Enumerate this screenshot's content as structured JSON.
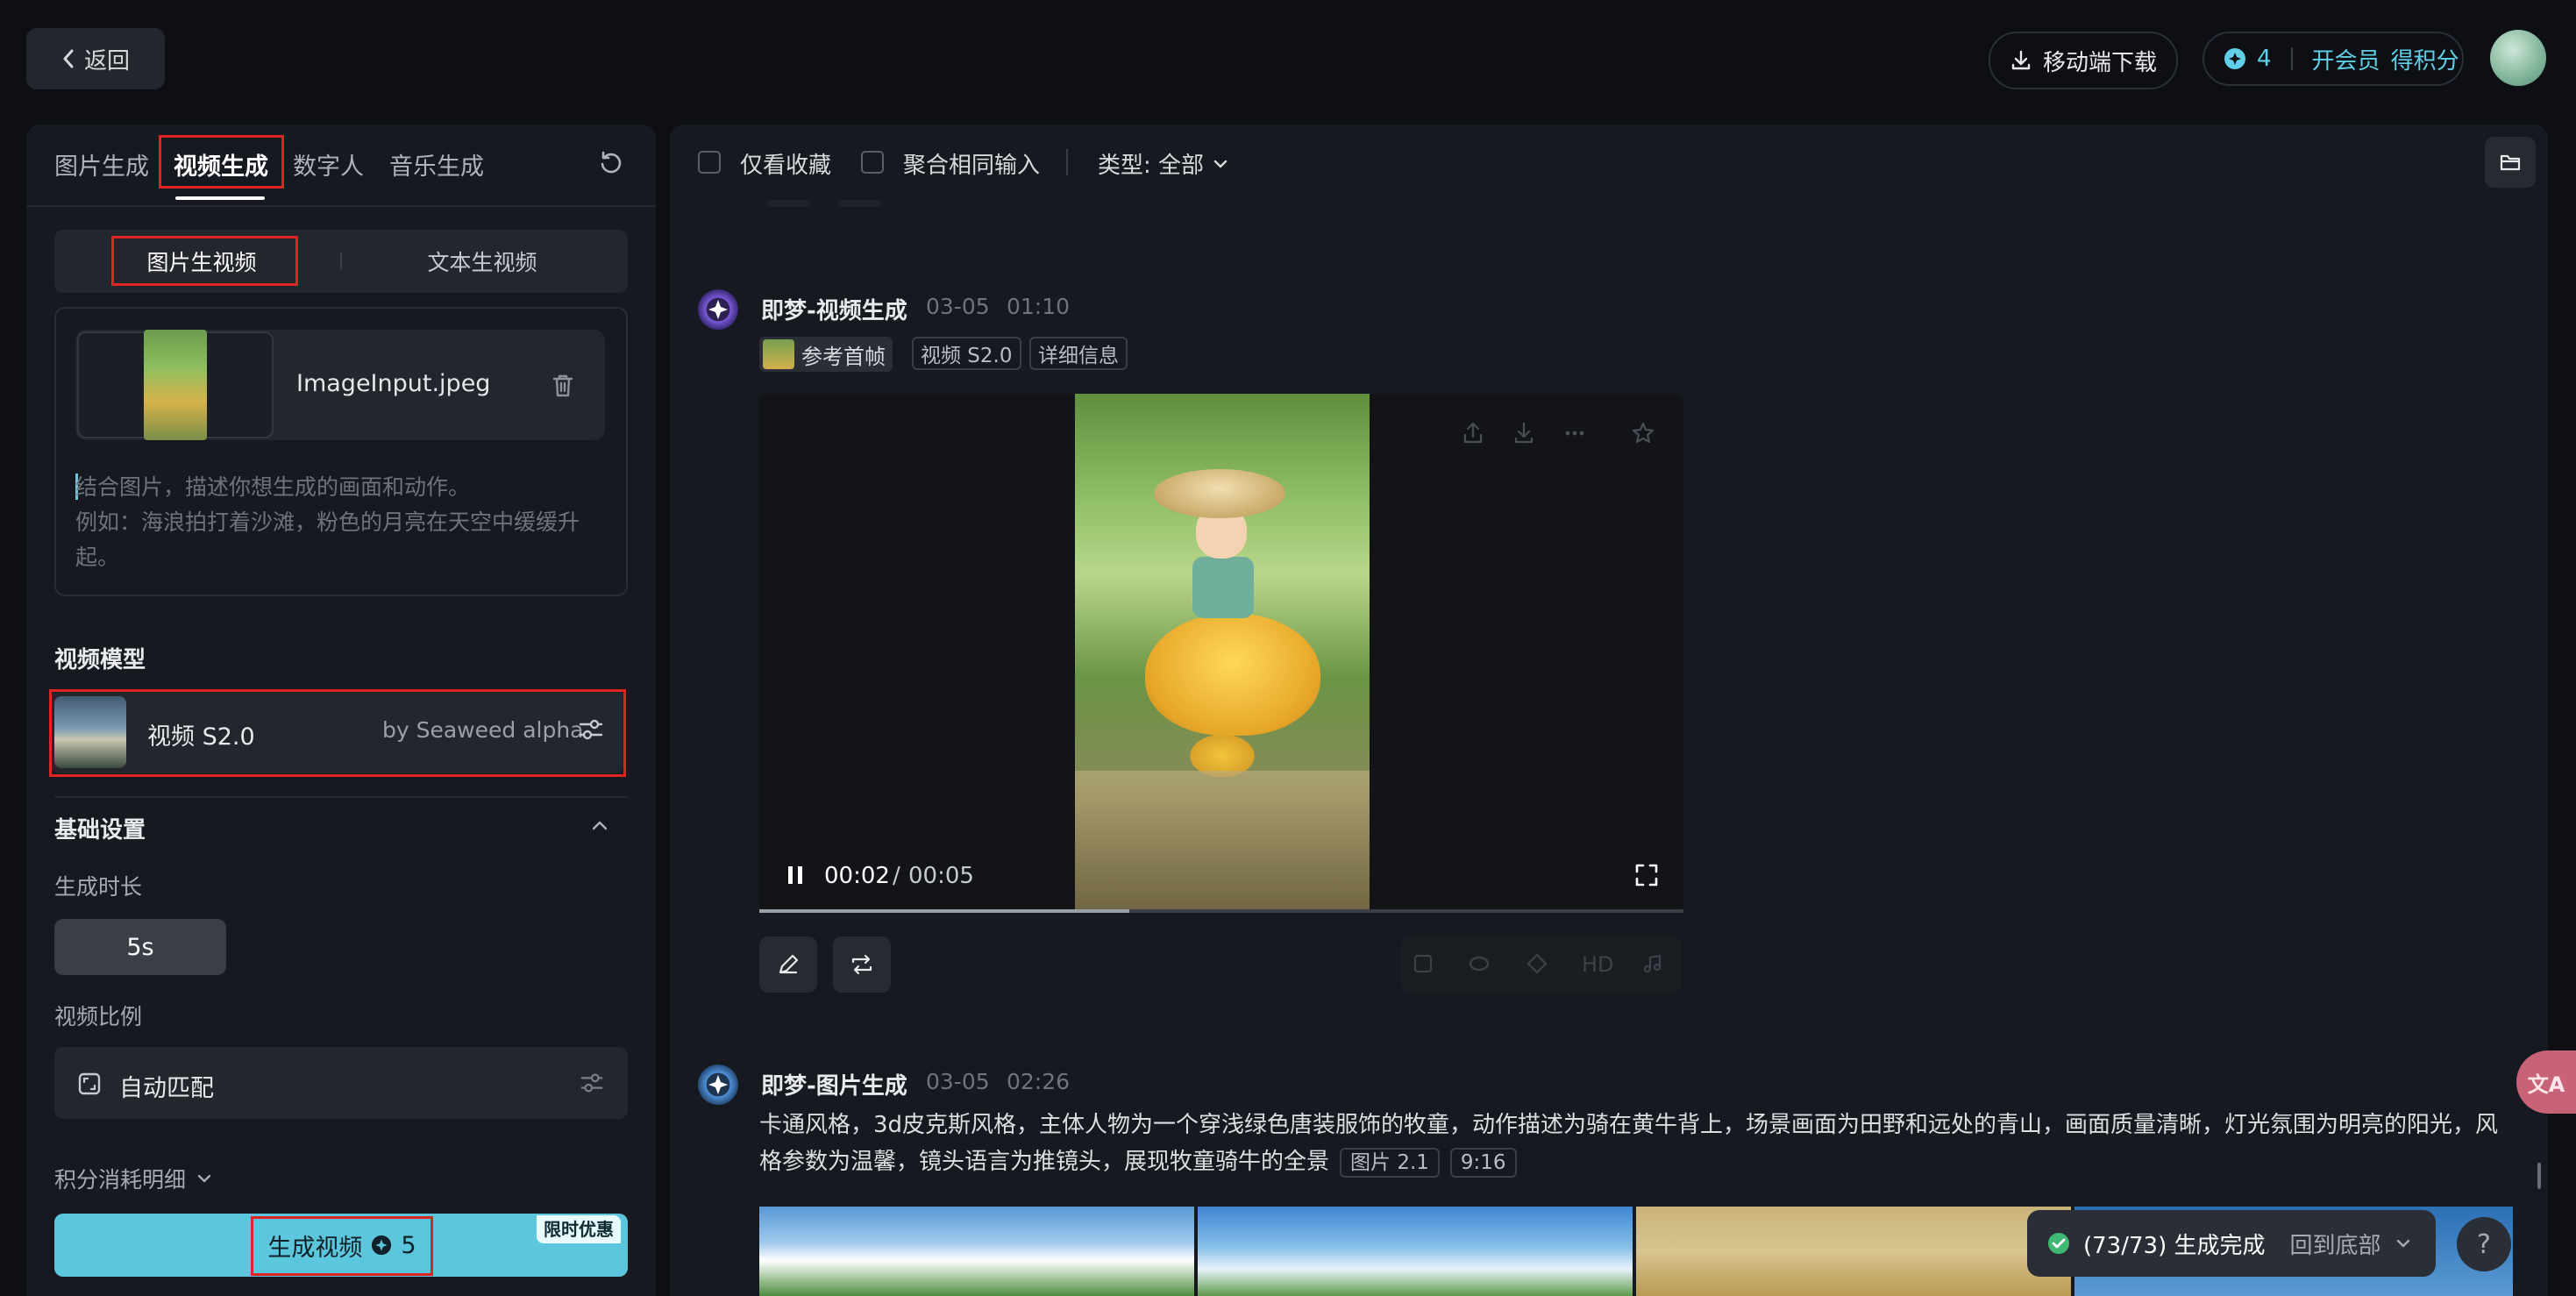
{
  "header": {
    "back_label": "返回",
    "download_label": "移动端下载",
    "points_count": "4",
    "vip_label": "开会员",
    "earn_label": "得积分"
  },
  "left": {
    "tabs": [
      "图片生成",
      "视频生成",
      "数字人",
      "音乐生成"
    ],
    "active_tab": "视频生成",
    "modes": [
      "图片生视频",
      "文本生视频"
    ],
    "active_mode": "图片生视频",
    "upload": {
      "filename": "ImageInput.jpeg"
    },
    "prompt": {
      "placeholder_line1": "结合图片，描述你想生成的画面和动作。",
      "placeholder_line2": "例如：海浪拍打着沙滩，粉色的月亮在天空中缓缓升起。"
    },
    "model_section_title": "视频模型",
    "model": {
      "name": "视频 S2.0",
      "by": "by Seaweed alpha"
    },
    "basic_settings_title": "基础设置",
    "duration_label": "生成时长",
    "duration_value": "5s",
    "ratio_label": "视频比例",
    "ratio_value": "自动匹配",
    "cost_detail_label": "积分消耗明细",
    "generate_label": "生成视频",
    "generate_cost": "5",
    "promo_badge": "限时优惠"
  },
  "toolbar": {
    "fav_only": "仅看收藏",
    "merge_inputs": "聚合相同输入",
    "type_filter": "类型: 全部"
  },
  "feed": {
    "item1": {
      "bot": "即梦-视频生成",
      "date": "03-05",
      "time": "01:10",
      "ref_tag": "参考首帧",
      "model_tag": "视频 S2.0",
      "detail_tag": "详细信息",
      "player": {
        "current": "00:02",
        "separator": "/",
        "total": "00:05",
        "progress": 0.4
      }
    },
    "item2": {
      "bot": "即梦-图片生成",
      "date": "03-05",
      "time": "02:26",
      "description": "卡通风格，3d皮克斯风格，主体人物为一个穿浅绿色唐装服饰的牧童，动作描述为骑在黄牛背上，场景画面为田野和远处的青山，画面质量清晰，灯光氛围为明亮的阳光，风格参数为温馨，镜头语言为推镜头，展现牧童骑牛的全景",
      "model_tag": "图片 2.1",
      "ratio_tag": "9:16"
    },
    "action_hd": "HD"
  },
  "toast": {
    "status": "(73/73) 生成完成",
    "back_to_bottom": "回到底部"
  },
  "help_label": "?",
  "translate_label": "文A",
  "colors": {
    "accent": "#5cc7dc",
    "highlight": "#e02424",
    "background": "#0d0f14",
    "panel": "#16191f"
  }
}
